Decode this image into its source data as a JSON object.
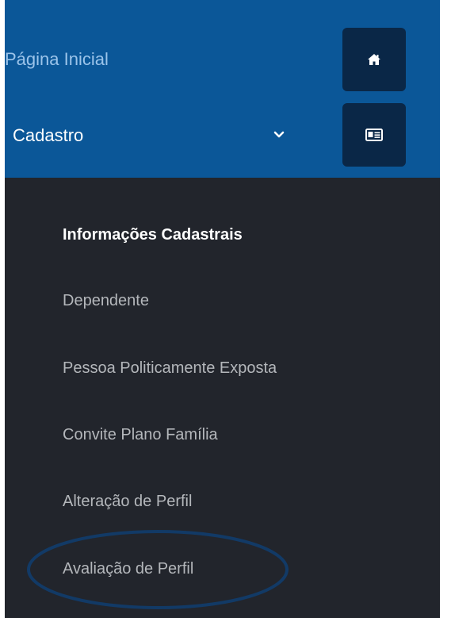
{
  "nav": {
    "home_label": "Página Inicial",
    "cadastro_label": "Cadastro",
    "home_icon": "home-icon",
    "cadastro_icon": "id-card-icon",
    "chevron_icon": "chevron-down-icon"
  },
  "submenu": {
    "items": [
      {
        "label": "Informações Cadastrais",
        "active": true
      },
      {
        "label": "Dependente",
        "active": false
      },
      {
        "label": "Pessoa Politicamente Exposta",
        "active": false
      },
      {
        "label": "Convite Plano Família",
        "active": false
      },
      {
        "label": "Alteração de Perfil",
        "active": false
      },
      {
        "label": "Avaliação de Perfil",
        "active": false,
        "circled": true
      }
    ]
  },
  "colors": {
    "top_nav_bg": "#0b5798",
    "sidebar_bg": "#22252c",
    "icon_tile_bg": "#0a2747",
    "home_label": "#9cc4ea",
    "submenu_text": "#b4b7bb",
    "submenu_active_text": "#ffffff",
    "highlight_ring": "#123a66"
  }
}
